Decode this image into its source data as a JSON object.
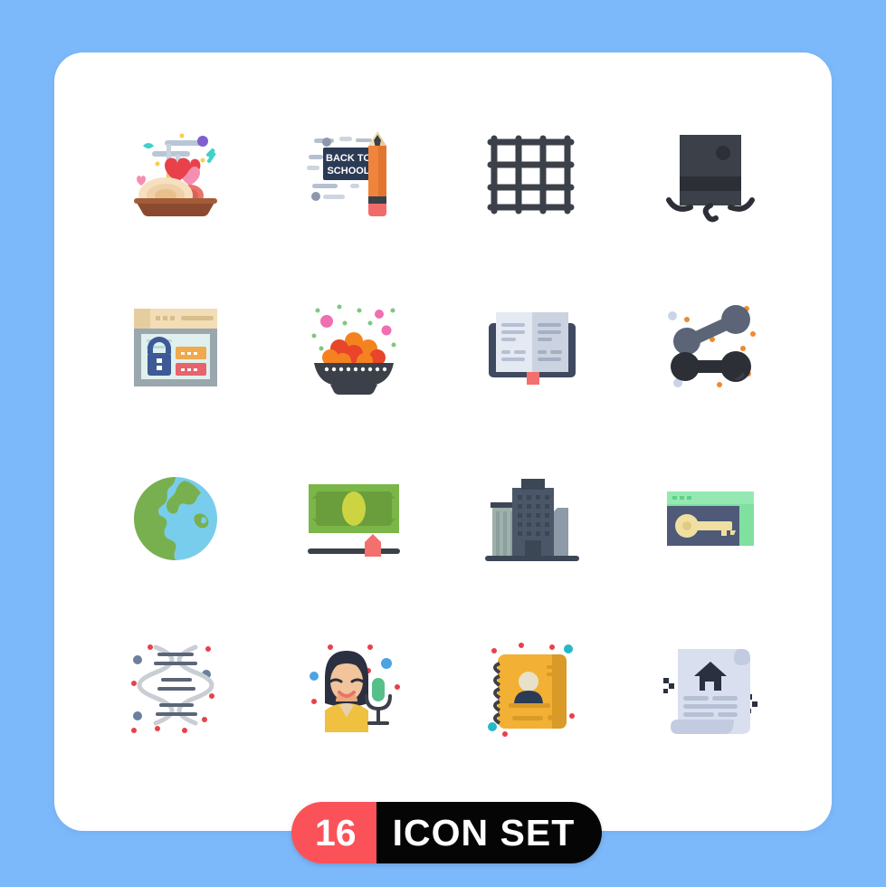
{
  "page": {
    "background_color": "#7cb9fb",
    "card_color": "#ffffff"
  },
  "banner": {
    "count": "16",
    "label": "ICON SET",
    "count_bg": "#fb5259",
    "label_bg": "#050505",
    "text_color": "#ffffff"
  },
  "grid": {
    "columns": 4,
    "rows": 4,
    "total_icons": 16
  },
  "icons": [
    {
      "index": 1,
      "name": "romantic-dinner-icon",
      "label": "Romantic Dinner",
      "row": 1,
      "col": 1,
      "colors": [
        "#f2d0a8",
        "#8b4a2f",
        "#e8414b",
        "#f48fb1",
        "#b0bec5"
      ]
    },
    {
      "index": 2,
      "name": "back-to-school-pencil-icon",
      "label": "Back To School",
      "row": 1,
      "col": 2,
      "text": "BACK TO SCHOOL",
      "colors": [
        "#2b3a55",
        "#f0843c",
        "#f26b6b",
        "#b0bac9"
      ]
    },
    {
      "index": 3,
      "name": "grid-layout-icon",
      "label": "Grid",
      "row": 1,
      "col": 3,
      "colors": [
        "#3c4049"
      ]
    },
    {
      "index": 4,
      "name": "top-hat-mustache-icon",
      "label": "Top Hat",
      "row": 1,
      "col": 4,
      "colors": [
        "#3c4049",
        "#2c2f35"
      ]
    },
    {
      "index": 5,
      "name": "browser-password-security-icon",
      "label": "Web Security",
      "row": 2,
      "col": 1,
      "colors": [
        "#f2ddb6",
        "#dff0ef",
        "#3d5a96",
        "#f0a94c",
        "#e8636b"
      ]
    },
    {
      "index": 6,
      "name": "sweets-bowl-laddu-icon",
      "label": "Sweets Bowl",
      "row": 2,
      "col": 2,
      "colors": [
        "#f58220",
        "#e8452a",
        "#3c4049",
        "#ef6fb0",
        "#7ec87e"
      ]
    },
    {
      "index": 7,
      "name": "open-book-icon",
      "label": "Open Book",
      "row": 2,
      "col": 3,
      "colors": [
        "#3f4a60",
        "#ccd3e0",
        "#f2706e"
      ]
    },
    {
      "index": 8,
      "name": "share-network-icon",
      "label": "Share",
      "row": 2,
      "col": 4,
      "colors": [
        "#5b6577",
        "#2c2f35",
        "#f08a2c",
        "#c9d4e8"
      ]
    },
    {
      "index": 9,
      "name": "globe-earth-icon",
      "label": "Globe",
      "row": 3,
      "col": 1,
      "colors": [
        "#79b04f",
        "#79cdec"
      ]
    },
    {
      "index": 10,
      "name": "budget-money-slider-icon",
      "label": "Budget",
      "row": 3,
      "col": 2,
      "colors": [
        "#7ab648",
        "#6a9e3d",
        "#cdd442",
        "#3c4049",
        "#f2706e"
      ]
    },
    {
      "index": 11,
      "name": "office-buildings-icon",
      "label": "Office Building",
      "row": 3,
      "col": 3,
      "colors": [
        "#4b5768",
        "#3c4756",
        "#9fb0ad",
        "#778d92"
      ]
    },
    {
      "index": 12,
      "name": "browser-key-access-icon",
      "label": "Access Key",
      "row": 3,
      "col": 4,
      "colors": [
        "#7fe0a0",
        "#4e5a78",
        "#f0dfa0"
      ]
    },
    {
      "index": 13,
      "name": "dna-helix-icon",
      "label": "DNA",
      "row": 4,
      "col": 1,
      "colors": [
        "#d9dde0",
        "#5b6577",
        "#6b7f9e",
        "#e8414b"
      ]
    },
    {
      "index": 14,
      "name": "female-reporter-mic-icon",
      "label": "Reporter",
      "row": 4,
      "col": 2,
      "colors": [
        "#2b3040",
        "#f2c49b",
        "#f0c040",
        "#56bf8a",
        "#4ba3e3"
      ]
    },
    {
      "index": 15,
      "name": "address-book-contacts-icon",
      "label": "Address Book",
      "row": 4,
      "col": 3,
      "colors": [
        "#f2b134",
        "#d99a28",
        "#3c4049",
        "#2b3a55",
        "#24b9c9"
      ]
    },
    {
      "index": 16,
      "name": "property-deed-document-icon",
      "label": "Property Document",
      "row": 4,
      "col": 4,
      "colors": [
        "#d9dfee",
        "#c3cbe0",
        "#2b3040"
      ]
    }
  ]
}
